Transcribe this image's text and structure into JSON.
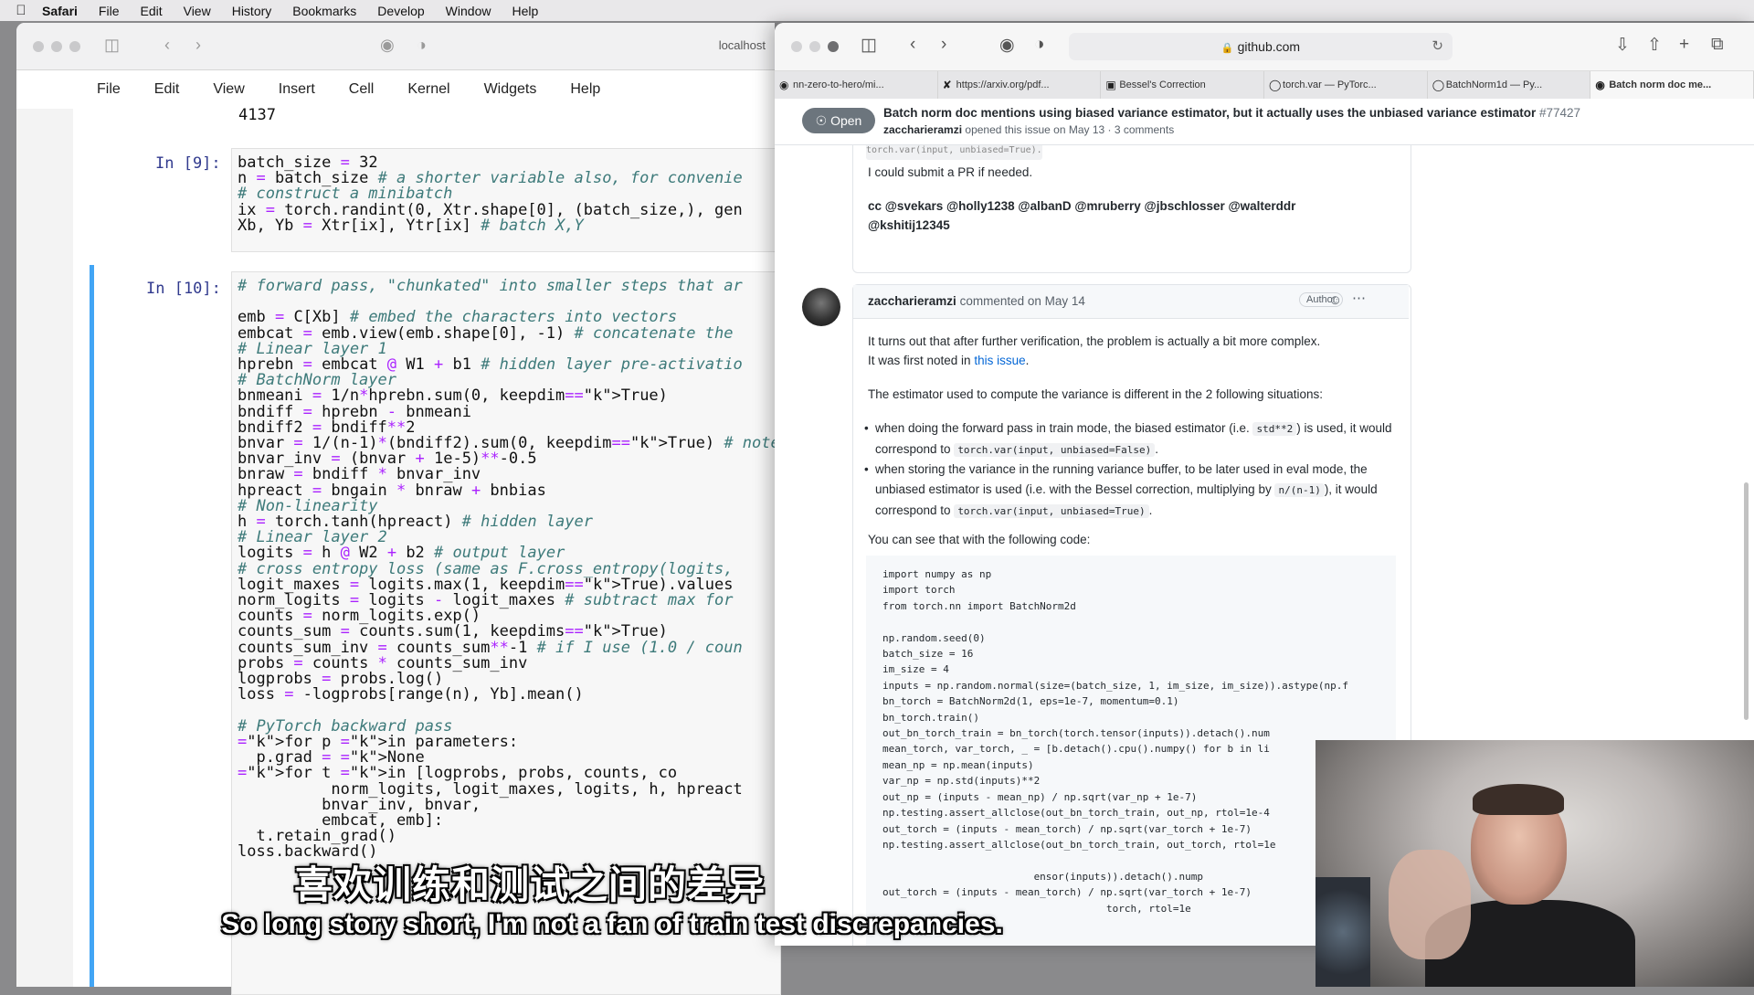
{
  "menubar": {
    "app": "Safari",
    "items": [
      "File",
      "Edit",
      "View",
      "History",
      "Bookmarks",
      "Develop",
      "Window",
      "Help"
    ]
  },
  "jupyter": {
    "address": "localhost",
    "menu": [
      "File",
      "Edit",
      "View",
      "Insert",
      "Cell",
      "Kernel",
      "Widgets",
      "Help"
    ],
    "output_prev": "4137",
    "cell9": {
      "prompt": "In [9]:",
      "lines": [
        "batch_size = 32",
        "n = batch_size # a shorter variable also, for convenie",
        "# construct a minibatch",
        "ix = torch.randint(0, Xtr.shape[0], (batch_size,), gen",
        "Xb, Yb = Xtr[ix], Ytr[ix] # batch X,Y"
      ]
    },
    "cell10": {
      "prompt": "In [10]:",
      "lines": [
        "# forward pass, \"chunkated\" into smaller steps that ar",
        "",
        "emb = C[Xb] # embed the characters into vectors",
        "embcat = emb.view(emb.shape[0], -1) # concatenate the",
        "# Linear layer 1",
        "hprebn = embcat @ W1 + b1 # hidden layer pre-activatio",
        "# BatchNorm layer",
        "bnmeani = 1/n*hprebn.sum(0, keepdim=True)",
        "bndiff = hprebn - bnmeani",
        "bndiff2 = bndiff**2",
        "bnvar = 1/(n-1)*(bndiff2).sum(0, keepdim=True) # note:",
        "bnvar_inv = (bnvar + 1e-5)**-0.5",
        "bnraw = bndiff * bnvar_inv",
        "hpreact = bngain * bnraw + bnbias",
        "# Non-linearity",
        "h = torch.tanh(hpreact) # hidden layer",
        "# Linear layer 2",
        "logits = h @ W2 + b2 # output layer",
        "# cross entropy loss (same as F.cross_entropy(logits,",
        "logit_maxes = logits.max(1, keepdim=True).values",
        "norm_logits = logits - logit_maxes # subtract max for",
        "counts = norm_logits.exp()",
        "counts_sum = counts.sum(1, keepdims=True)",
        "counts_sum_inv = counts_sum**-1 # if I use (1.0 / coun",
        "probs = counts * counts_sum_inv",
        "logprobs = probs.log()",
        "loss = -logprobs[range(n), Yb].mean()",
        "",
        "# PyTorch backward pass",
        "for p in parameters:",
        "  p.grad = None",
        "for t in [logprobs, probs, counts, co",
        "          norm_logits, logit_maxes, logits, h, hpreact",
        "         bnvar_inv, bnvar,",
        "         embcat, emb]:",
        "  t.retain_grad()",
        "loss.backward()"
      ]
    }
  },
  "safari": {
    "url": "github.com",
    "tabs": [
      {
        "label": "nn-zero-to-hero/mi...",
        "icon": "github-icon"
      },
      {
        "label": "https://arxiv.org/pdf...",
        "icon": "arxiv-icon"
      },
      {
        "label": "Bessel's Correction",
        "icon": "page-icon"
      },
      {
        "label": "torch.var — PyTorc...",
        "icon": "pytorch-icon"
      },
      {
        "label": "BatchNorm1d — Py...",
        "icon": "pytorch-icon"
      },
      {
        "label": "Batch norm doc me...",
        "icon": "github-icon",
        "active": true
      }
    ]
  },
  "issue": {
    "status": "Open",
    "title": "Batch norm doc mentions using biased variance estimator, but it actually uses the unbiased variance estimator",
    "number": "#77427",
    "author": "zaccharieramzi",
    "meta": "opened this issue on May 13 · 3 comments",
    "prev_comment": {
      "cut_line": "torch.var(input, unbiased=True).",
      "pr_line": "I could submit a PR if needed.",
      "cc_line1": "cc @svekars @holly1238 @albanD @mruberry @jbschlosser @walterddr",
      "cc_line2": "@kshitij12345"
    },
    "comment": {
      "author": "zaccharieramzi",
      "when": "commented on May 14",
      "badge": "Author",
      "p1_line1": "It turns out that after further verification, the problem is actually a bit more complex.",
      "p1_line2_pre": "It was first noted in ",
      "p1_link": "this issue",
      "p1_line2_post": ".",
      "p2": "The estimator used to compute the variance is different in the 2 following situations:",
      "b1_pre": "when doing the forward pass in train mode, the biased estimator (i.e. ",
      "b1_code": "std**2",
      "b1_mid": ") is used, it would correspond to ",
      "b1_code2": "torch.var(input, unbiased=False)",
      "b1_end": ".",
      "b2_pre": "when storing the variance in the running variance buffer, to be later used in eval mode, the unbiased estimator is used (i.e. with the Bessel correction, multiplying by ",
      "b2_code": "n/(n-1)",
      "b2_mid": "), it would correspond to ",
      "b2_code2": "torch.var(input, unbiased=True)",
      "b2_end": ".",
      "p3": "You can see that with the following code:",
      "code_lines": [
        "import numpy as np",
        "import torch",
        "from torch.nn import BatchNorm2d",
        "",
        "np.random.seed(0)",
        "batch_size = 16",
        "im_size = 4",
        "inputs = np.random.normal(size=(batch_size, 1, im_size, im_size)).astype(np.f",
        "bn_torch = BatchNorm2d(1, eps=1e-7, momentum=0.1)",
        "bn_torch.train()",
        "out_bn_torch_train = bn_torch(torch.tensor(inputs)).detach().num",
        "mean_torch, var_torch, _ = [b.detach().cpu().numpy() for b in li",
        "mean_np = np.mean(inputs)",
        "var_np = np.std(inputs)**2",
        "out_np = (inputs - mean_np) / np.sqrt(var_np + 1e-7)",
        "np.testing.assert_allclose(out_bn_torch_train, out_np, rtol=1e-4",
        "out_torch = (inputs - mean_torch) / np.sqrt(var_torch + 1e-7)",
        "np.testing.assert_allclose(out_bn_torch_train, out_torch, rtol=1e",
        "",
        "                         ensor(inputs)).detach().nump",
        "out_torch = (inputs - mean_torch) / np.sqrt(var_torch + 1e-7)",
        "                                     torch, rtol=1e"
      ]
    }
  },
  "subtitles": {
    "chinese": "喜欢训练和测试之间的差异",
    "english": "So long story short, I'm not a fan of train test discrepancies."
  }
}
